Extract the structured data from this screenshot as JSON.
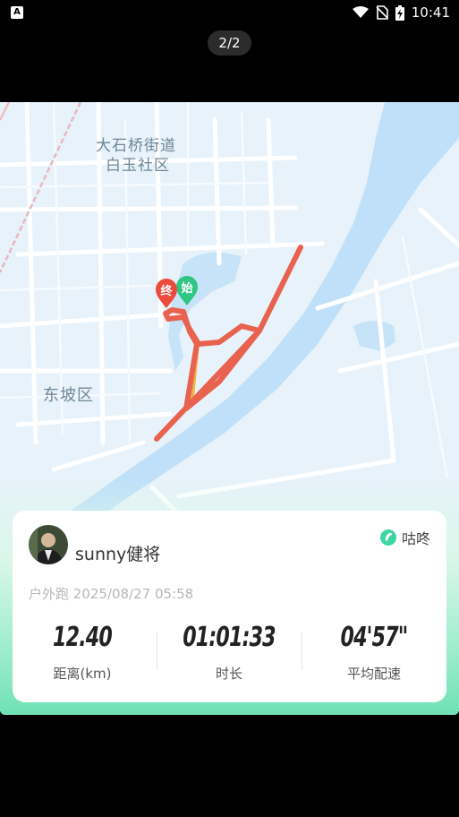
{
  "status_bar": {
    "left_icon": "A",
    "time": "10:41",
    "icons": [
      "wifi-icon",
      "no-sim-icon",
      "battery-charging-icon"
    ]
  },
  "page_indicator": "2/2",
  "map": {
    "labels": {
      "district_line1": "大石桥街道",
      "district_line2": "白玉社区",
      "dongpo": "东坡区"
    },
    "markers": {
      "start": "始",
      "end": "终"
    },
    "colors": {
      "route": "#e8624f",
      "route_slow": "#efb145",
      "river": "#bfe0f8",
      "road": "#ffffff",
      "start_marker": "#2fc583",
      "end_marker": "#ec4a3c"
    }
  },
  "card": {
    "username": "sunny健将",
    "brand_name": "咕咚",
    "brand_icon": "gudong-logo-icon",
    "activity_meta": "户外跑 2025/08/27 05:58",
    "stats": [
      {
        "value": "12.40",
        "label": "距离(km)"
      },
      {
        "value": "01:01:33",
        "label": "时长"
      },
      {
        "value": "04'57\"",
        "label": "平均配速"
      }
    ]
  }
}
